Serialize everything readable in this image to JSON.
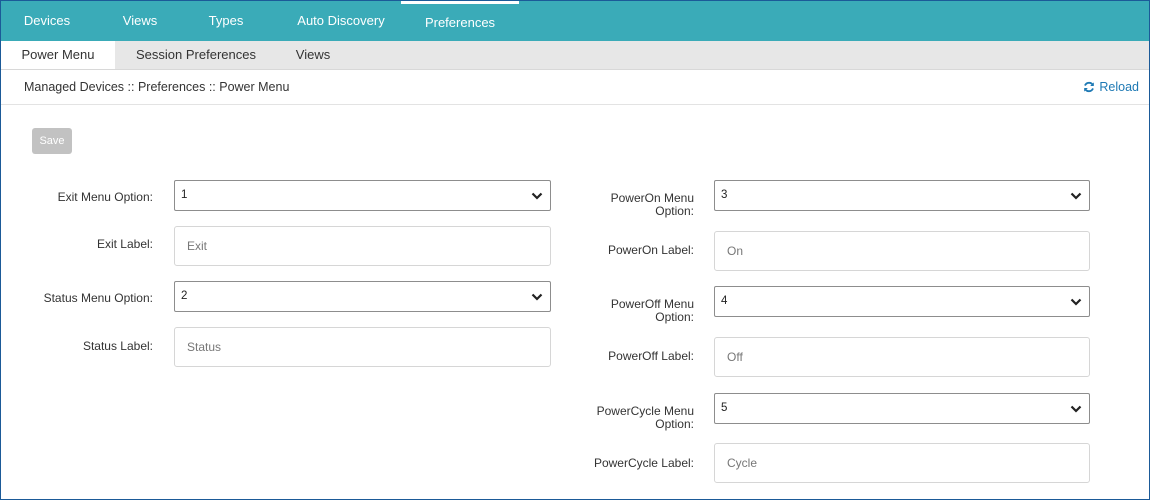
{
  "top_nav": {
    "items": [
      "Devices",
      "Views",
      "Types",
      "Auto Discovery",
      "Preferences"
    ],
    "active": "Preferences"
  },
  "sub_nav": {
    "items": [
      "Power Menu",
      "Session Preferences",
      "Views"
    ],
    "active": "Power Menu"
  },
  "breadcrumb": "Managed Devices :: Preferences :: Power Menu",
  "reload_label": "Reload",
  "save_label": "Save",
  "form": {
    "exit_menu_option": {
      "label": "Exit Menu Option:",
      "value": "1"
    },
    "exit_label": {
      "label": "Exit Label:",
      "placeholder": "Exit"
    },
    "status_menu_option": {
      "label": "Status Menu Option:",
      "value": "2"
    },
    "status_label": {
      "label": "Status Label:",
      "placeholder": "Status"
    },
    "poweron_menu_option": {
      "label_line1": "PowerOn Menu",
      "label_line2": "Option:",
      "value": "3"
    },
    "poweron_label": {
      "label": "PowerOn Label:",
      "placeholder": "On"
    },
    "poweroff_menu_option": {
      "label_line1": "PowerOff Menu",
      "label_line2": "Option:",
      "value": "4"
    },
    "poweroff_label": {
      "label": "PowerOff Label:",
      "placeholder": "Off"
    },
    "powercycle_menu_option": {
      "label_line1": "PowerCycle Menu",
      "label_line2": "Option:",
      "value": "5"
    },
    "powercycle_label": {
      "label": "PowerCycle Label:",
      "placeholder": "Cycle"
    }
  },
  "colors": {
    "top_nav_bg": "#3aabb8",
    "sub_nav_bg": "#e7e7e7",
    "link": "#1e79b4",
    "save_disabled": "#c2c2c2"
  },
  "icons": {
    "reload": "reload-icon",
    "dropdown": "chevron-down-icon"
  }
}
